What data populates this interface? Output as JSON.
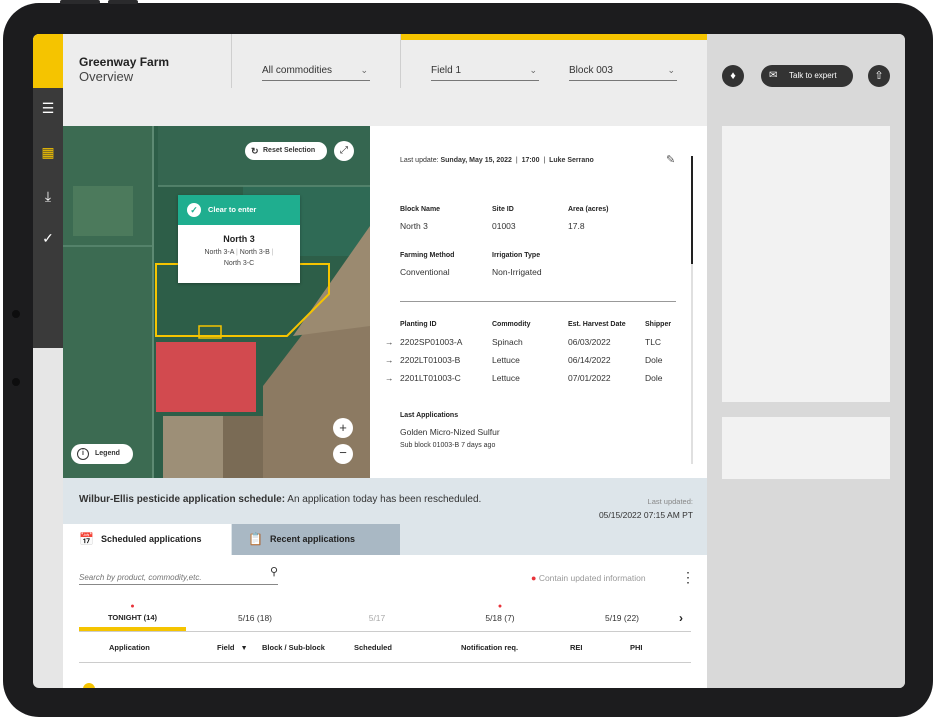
{
  "header": {
    "title": "Greenway Farm",
    "subtitle": "Overview",
    "commodities_select": "All commodities",
    "field_select": "Field 1",
    "block_select": "Block 003",
    "talk_to_expert": "Talk to expert"
  },
  "map": {
    "reset_selection": "Reset Selection",
    "popup_status": "Clear to enter",
    "popup_title": "North 3",
    "popup_subblocks": [
      "North 3-A",
      "North 3-B",
      "North 3-C"
    ],
    "legend": "Legend"
  },
  "info": {
    "last_update_label": "Last update:",
    "last_update_date": "Sunday, May 15, 2022",
    "last_update_time": "17:00",
    "last_update_user": "Luke Serrano",
    "labels": {
      "block_name": "Block Name",
      "site_id": "Site ID",
      "area": "Area (acres)",
      "farming_method": "Farming Method",
      "irrigation_type": "Irrigation Type",
      "planting_id": "Planting ID",
      "commodity": "Commodity",
      "est_harvest": "Est. Harvest Date",
      "shipper": "Shipper",
      "last_applications": "Last Applications"
    },
    "block_name": "North 3",
    "site_id": "01003",
    "area": "17.8",
    "farming_method": "Conventional",
    "irrigation_type": "Non-Irrigated",
    "plantings": [
      {
        "id": "2202SP01003-A",
        "commodity": "Spinach",
        "harvest": "06/03/2022",
        "shipper": "TLC"
      },
      {
        "id": "2202LT01003-B",
        "commodity": "Lettuce",
        "harvest": "06/14/2022",
        "shipper": "Dole"
      },
      {
        "id": "2201LT01003-C",
        "commodity": "Lettuce",
        "harvest": "07/01/2022",
        "shipper": "Dole"
      }
    ],
    "last_application_product": "Golden Micro-Nized Sulfur",
    "last_application_detail": "Sub block 01003-B  7 days ago"
  },
  "schedule": {
    "banner_title": "Wilbur-Ellis pesticide application schedule:",
    "banner_msg": "An application today has been rescheduled.",
    "last_updated_label": "Last updated:",
    "last_updated_value": "05/15/2022  07:15 AM PT",
    "tab_scheduled": "Scheduled applications",
    "tab_recent": "Recent applications",
    "search_placeholder": "Search by product, commodity,etc.",
    "legend_note": "Contain updated information",
    "days": [
      {
        "label": "TONIGHT (14)",
        "dot": true
      },
      {
        "label": "5/16 (18)",
        "dot": false
      },
      {
        "label": "5/17",
        "dot": false
      },
      {
        "label": "5/18 (7)",
        "dot": true
      },
      {
        "label": "5/19 (22)",
        "dot": false
      }
    ],
    "columns": [
      "Application",
      "Field",
      "Block / Sub-block",
      "Scheduled",
      "Notification req.",
      "REI",
      "PHI"
    ]
  },
  "colors": {
    "accent": "#f5c400",
    "success": "#1fae8f",
    "alert_dot": "#e8333a",
    "sidebar": "#3a3a3a"
  }
}
